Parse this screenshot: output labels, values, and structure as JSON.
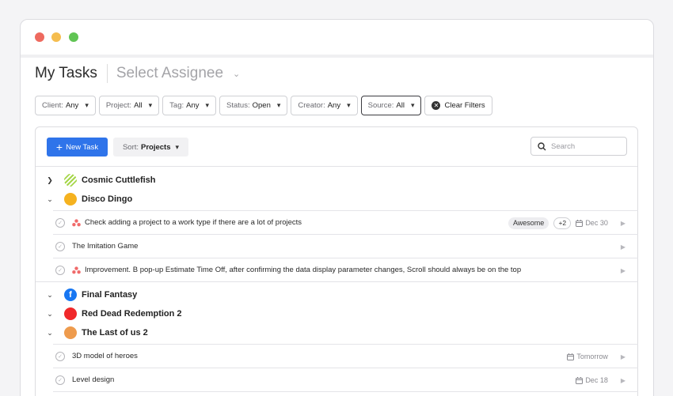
{
  "header": {
    "title": "My Tasks",
    "assignee_placeholder": "Select Assignee"
  },
  "filters": [
    {
      "label": "Client:",
      "value": "Any"
    },
    {
      "label": "Project:",
      "value": "All"
    },
    {
      "label": "Tag:",
      "value": "Any"
    },
    {
      "label": "Status:",
      "value": "Open"
    },
    {
      "label": "Creator:",
      "value": "Any"
    },
    {
      "label": "Source:",
      "value": "All"
    }
  ],
  "clear_filters_label": "Clear Filters",
  "toolbar": {
    "new_task_label": "New Task",
    "sort_label": "Sort:",
    "sort_value": "Projects",
    "search_placeholder": "Search"
  },
  "projects": [
    {
      "name": "Cosmic Cuttlefish",
      "color": "#a6d64a",
      "expanded": false
    },
    {
      "name": "Disco Dingo",
      "color": "#f5b21f",
      "expanded": true
    },
    {
      "name": "Final Fantasy",
      "color": "#1877f2",
      "expanded": true
    },
    {
      "name": "Red Dead Redemption 2",
      "color": "#f0282a",
      "expanded": true
    },
    {
      "name": "The Last of us 2",
      "color": "#ee9b4d",
      "expanded": true
    }
  ],
  "tasks": [
    {
      "title": "Check adding a project to a work type if there are a lot of projects",
      "tag": "Awesome",
      "more": "+2",
      "date": "Dec 30",
      "source": "asana"
    },
    {
      "title": "The Imitation Game"
    },
    {
      "title": "Improvement. B pop-up Estimate Time Off, after confirming the data display parameter changes, Scroll should always be on the top",
      "source": "asana"
    },
    {
      "title": "3D model of heroes",
      "date": "Tomorrow"
    },
    {
      "title": "Level design",
      "date": "Dec 18"
    }
  ],
  "colors": {
    "accent": "#2f74ea",
    "asana": "#f06a6a"
  }
}
